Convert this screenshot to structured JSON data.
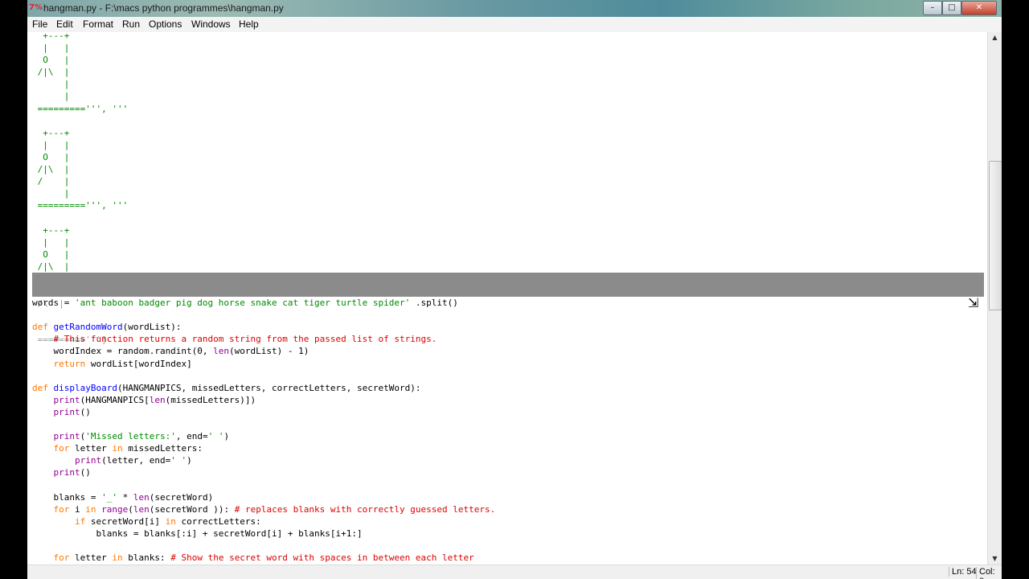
{
  "window": {
    "icon": "idle-icon",
    "title": "hangman.py - F:\\macs python programmes\\hangman.py",
    "minimize_label": "–",
    "maximize_label": "□",
    "close_label": "✕"
  },
  "menu": [
    "File",
    "Edit",
    "Format",
    "Run",
    "Options",
    "Windows",
    "Help"
  ],
  "code_lines": [
    [
      {
        "t": "  +---+",
        "c": "str"
      }
    ],
    [
      {
        "t": "  |   |",
        "c": "str"
      }
    ],
    [
      {
        "t": "  O   |",
        "c": "str"
      }
    ],
    [
      {
        "t": " /|\\  |",
        "c": "str"
      }
    ],
    [
      {
        "t": "      |",
        "c": "str"
      }
    ],
    [
      {
        "t": "      |",
        "c": "str"
      }
    ],
    [
      {
        "t": " =========''', '''",
        "c": "str"
      }
    ],
    [
      {
        "t": "",
        "c": ""
      }
    ],
    [
      {
        "t": "  +---+",
        "c": "str"
      }
    ],
    [
      {
        "t": "  |   |",
        "c": "str"
      }
    ],
    [
      {
        "t": "  O   |",
        "c": "str"
      }
    ],
    [
      {
        "t": " /|\\  |",
        "c": "str"
      }
    ],
    [
      {
        "t": " /    |",
        "c": "str"
      }
    ],
    [
      {
        "t": "      |",
        "c": "str"
      }
    ],
    [
      {
        "t": " =========''', '''",
        "c": "str"
      }
    ],
    [
      {
        "t": "",
        "c": ""
      }
    ],
    [
      {
        "t": "  +---+",
        "c": "str"
      }
    ],
    [
      {
        "t": "  |   |",
        "c": "str"
      }
    ],
    [
      {
        "t": "  O   |",
        "c": "str"
      }
    ],
    [
      {
        "t": " /|\\  |",
        "c": "str"
      }
    ],
    [
      {
        "t": "",
        "c": ""
      }
    ],
    [
      {
        "t": "",
        "c": ""
      }
    ],
    [
      {
        "t": "words = ",
        "c": ""
      },
      {
        "t": "'ant baboon badger pig dog horse snake cat tiger turtle spider'",
        "c": "str"
      },
      {
        "t": " .split()",
        "c": ""
      }
    ],
    [
      {
        "t": "",
        "c": ""
      }
    ],
    [
      {
        "t": "def",
        "c": "kw"
      },
      {
        "t": " ",
        "c": ""
      },
      {
        "t": "getRandomWord",
        "c": "def"
      },
      {
        "t": "(wordList):",
        "c": ""
      }
    ],
    [
      {
        "t": "    ",
        "c": ""
      },
      {
        "t": "# This function returns a random string from the passed list of strings.",
        "c": "cm"
      }
    ],
    [
      {
        "t": "    wordIndex = random.randint(0, ",
        "c": ""
      },
      {
        "t": "len",
        "c": "bi"
      },
      {
        "t": "(wordList) - 1)",
        "c": ""
      }
    ],
    [
      {
        "t": "    ",
        "c": ""
      },
      {
        "t": "return",
        "c": "kw"
      },
      {
        "t": " wordList[wordIndex]",
        "c": ""
      }
    ],
    [
      {
        "t": "",
        "c": ""
      }
    ],
    [
      {
        "t": "def",
        "c": "kw"
      },
      {
        "t": " ",
        "c": ""
      },
      {
        "t": "displayBoard",
        "c": "def"
      },
      {
        "t": "(HANGMANPICS, missedLetters, correctLetters, secretWord):",
        "c": ""
      }
    ],
    [
      {
        "t": "    ",
        "c": ""
      },
      {
        "t": "print",
        "c": "bi"
      },
      {
        "t": "(HANGMANPICS[",
        "c": ""
      },
      {
        "t": "len",
        "c": "bi"
      },
      {
        "t": "(missedLetters)])",
        "c": ""
      }
    ],
    [
      {
        "t": "    ",
        "c": ""
      },
      {
        "t": "print",
        "c": "bi"
      },
      {
        "t": "()",
        "c": ""
      }
    ],
    [
      {
        "t": "",
        "c": ""
      }
    ],
    [
      {
        "t": "    ",
        "c": ""
      },
      {
        "t": "print",
        "c": "bi"
      },
      {
        "t": "(",
        "c": ""
      },
      {
        "t": "'Missed letters:'",
        "c": "str"
      },
      {
        "t": ", end=",
        "c": ""
      },
      {
        "t": "' '",
        "c": "str"
      },
      {
        "t": ")",
        "c": ""
      }
    ],
    [
      {
        "t": "    ",
        "c": ""
      },
      {
        "t": "for",
        "c": "kw"
      },
      {
        "t": " letter ",
        "c": ""
      },
      {
        "t": "in",
        "c": "kw"
      },
      {
        "t": " missedLetters:",
        "c": ""
      }
    ],
    [
      {
        "t": "        ",
        "c": ""
      },
      {
        "t": "print",
        "c": "bi"
      },
      {
        "t": "(letter, end=",
        "c": ""
      },
      {
        "t": "' '",
        "c": "str"
      },
      {
        "t": ")",
        "c": ""
      }
    ],
    [
      {
        "t": "    ",
        "c": ""
      },
      {
        "t": "print",
        "c": "bi"
      },
      {
        "t": "()",
        "c": ""
      }
    ],
    [
      {
        "t": "",
        "c": ""
      }
    ],
    [
      {
        "t": "    blanks = ",
        "c": ""
      },
      {
        "t": "'_'",
        "c": "str"
      },
      {
        "t": " * ",
        "c": ""
      },
      {
        "t": "len",
        "c": "bi"
      },
      {
        "t": "(secretWord)",
        "c": ""
      }
    ],
    [
      {
        "t": "    ",
        "c": ""
      },
      {
        "t": "for",
        "c": "kw"
      },
      {
        "t": " i ",
        "c": ""
      },
      {
        "t": "in",
        "c": "kw"
      },
      {
        "t": " ",
        "c": ""
      },
      {
        "t": "range",
        "c": "bi"
      },
      {
        "t": "(",
        "c": ""
      },
      {
        "t": "len",
        "c": "bi"
      },
      {
        "t": "(secretWord )): ",
        "c": ""
      },
      {
        "t": "# replaces blanks with correctly guessed letters.",
        "c": "cm"
      }
    ],
    [
      {
        "t": "        ",
        "c": ""
      },
      {
        "t": "if",
        "c": "kw"
      },
      {
        "t": " secretWord[i] ",
        "c": ""
      },
      {
        "t": "in",
        "c": "kw"
      },
      {
        "t": " correctLetters:",
        "c": ""
      }
    ],
    [
      {
        "t": "            blanks = blanks[:i] + secretWord[i] + blanks[i+1:]",
        "c": ""
      }
    ],
    [
      {
        "t": "",
        "c": ""
      }
    ],
    [
      {
        "t": "    ",
        "c": ""
      },
      {
        "t": "for",
        "c": "kw"
      },
      {
        "t": " letter ",
        "c": ""
      },
      {
        "t": "in",
        "c": "kw"
      },
      {
        "t": " blanks: ",
        "c": ""
      },
      {
        "t": "# Show the secret word with spaces in between each letter",
        "c": "cm"
      }
    ]
  ],
  "selection_ghost": [
    " /\\  |",
    " =========''']"
  ],
  "colors": {
    "string": "#008a00",
    "keyword": "#ff7700",
    "definition": "#0000ff",
    "builtin": "#900090",
    "comment": "#dd0000",
    "selection": "#7e7e7e"
  },
  "scrollbar": {
    "up_icon": "scroll-up-arrow-icon",
    "down_icon": "scroll-down-arrow-icon"
  },
  "status": {
    "ln": "Ln: 54",
    "col": "Col: 0"
  }
}
